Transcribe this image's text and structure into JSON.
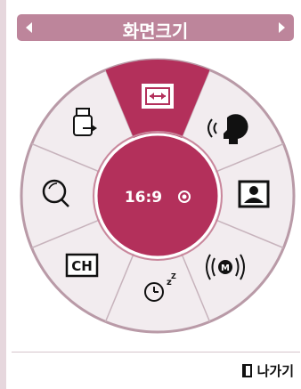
{
  "header": {
    "title": "화면크기",
    "prev_icon": "triangle-left",
    "next_icon": "triangle-right"
  },
  "wheel": {
    "center_value": "16:9",
    "center_indicator_icon": "target-circle",
    "selected_item": "aspect-ratio",
    "items": [
      {
        "name": "aspect-ratio",
        "icon": "double-arrow-horizontal",
        "selected": true
      },
      {
        "name": "voice",
        "icon": "speaking-head"
      },
      {
        "name": "picture",
        "icon": "person-portrait"
      },
      {
        "name": "audio-mode",
        "icon": "circled-M-waves",
        "label": "M"
      },
      {
        "name": "sleep-timer",
        "icon": "clock-zz",
        "label": "zZ"
      },
      {
        "name": "channel",
        "icon": "CH-box",
        "label": "CH"
      },
      {
        "name": "zoom",
        "icon": "magnifier"
      },
      {
        "name": "input",
        "icon": "input-plug-arrow"
      }
    ]
  },
  "footer": {
    "exit_label": "나가기",
    "exit_icon": "door"
  },
  "colors": {
    "accent": "#b3305b",
    "accent_light": "#c9879c",
    "title_bar": "#bd859b",
    "wheel_bg": "#f2ecef",
    "wheel_border": "#b99aa7"
  }
}
